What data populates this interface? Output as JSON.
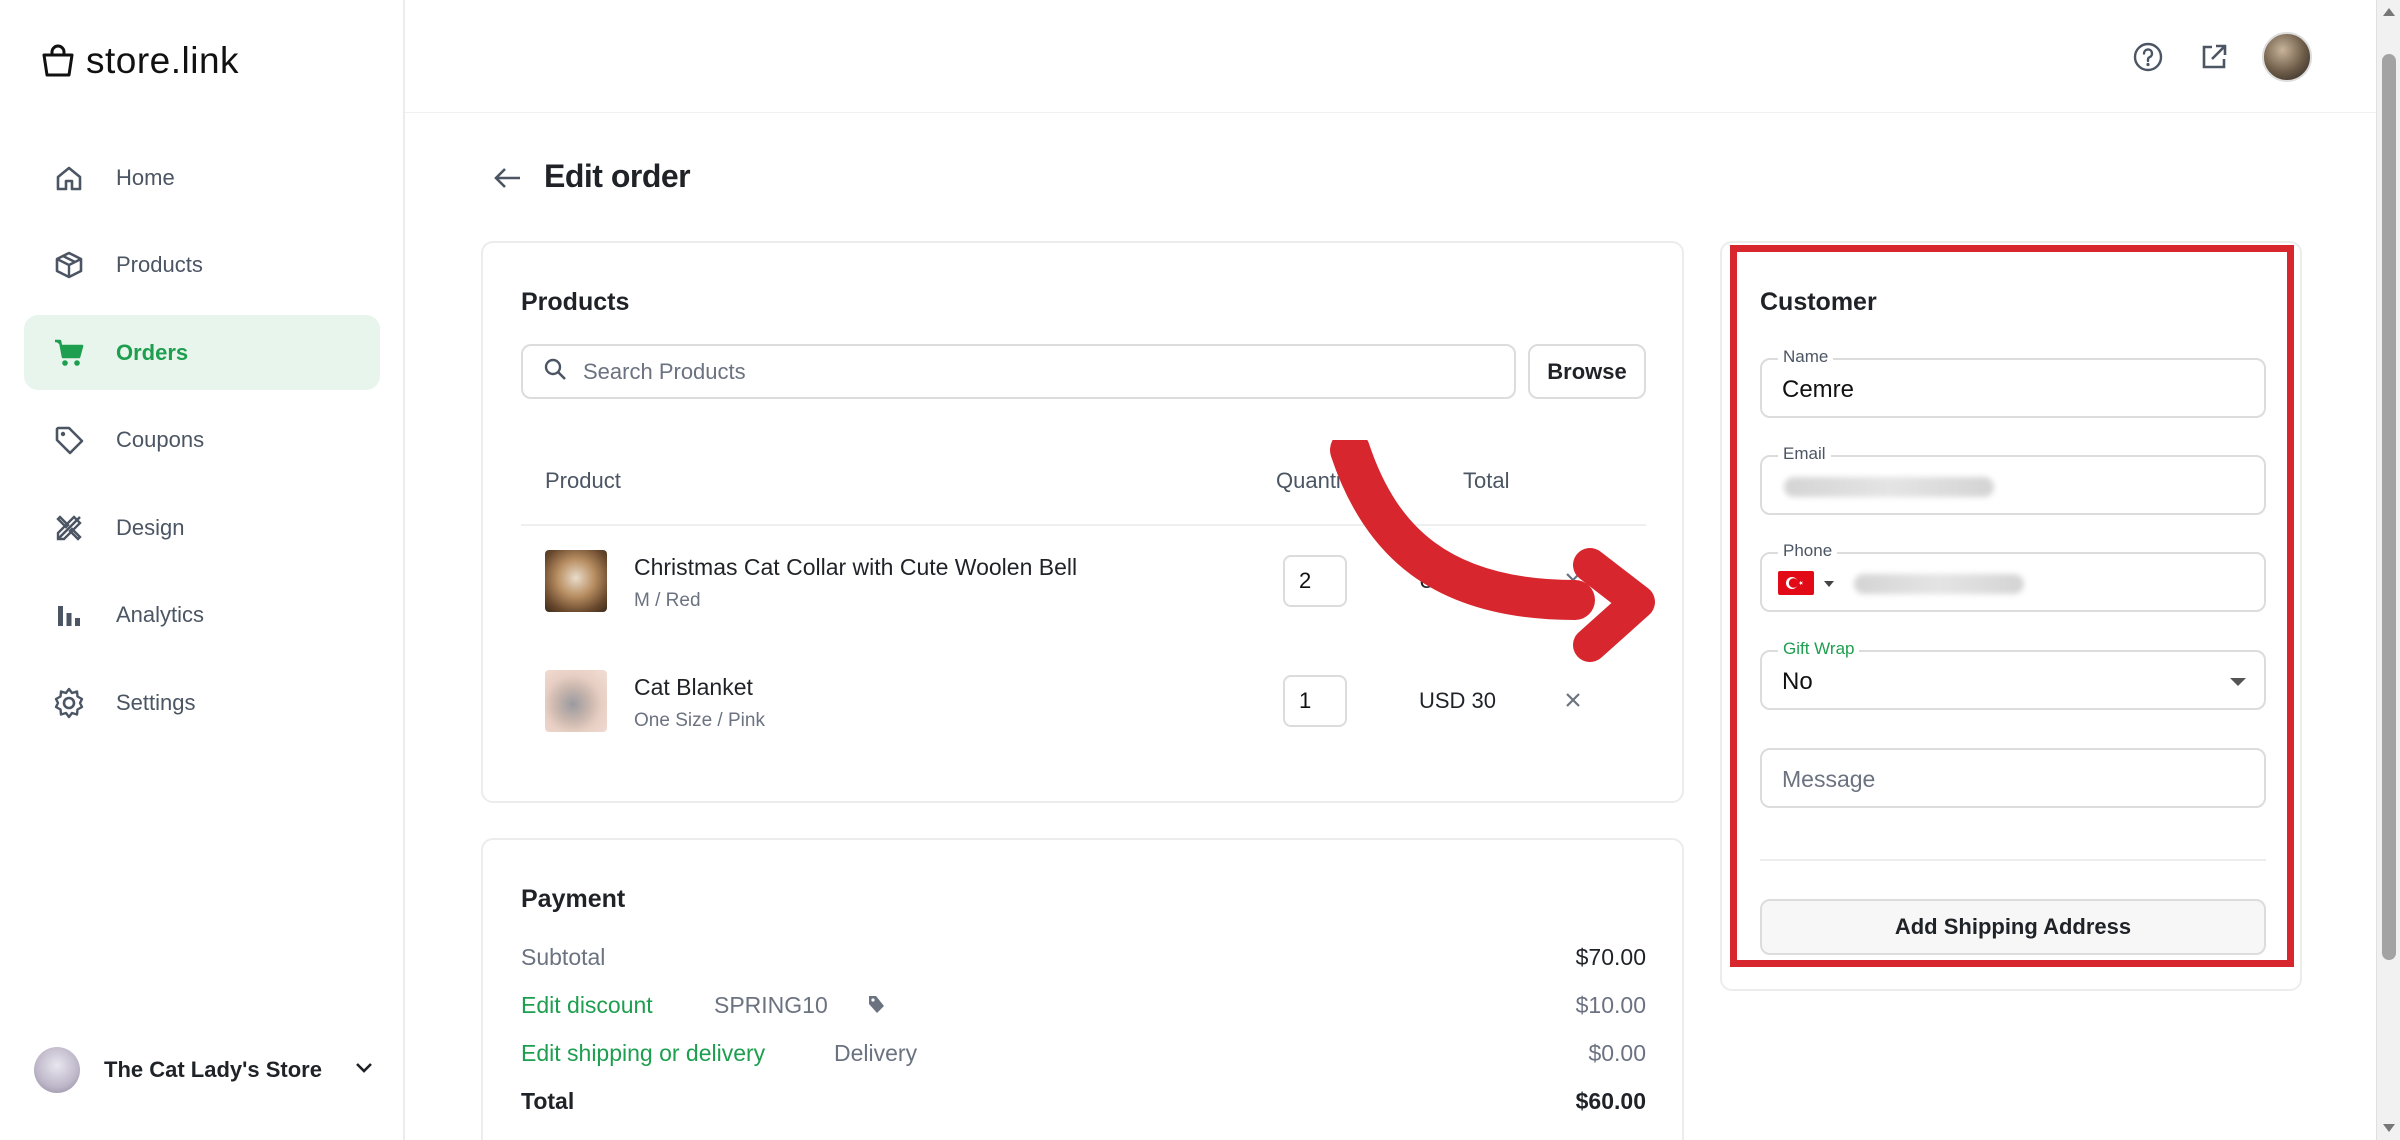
{
  "brand": {
    "name": "store.link"
  },
  "sidebar": {
    "items": [
      {
        "label": "Home",
        "icon": "home-icon",
        "active": false
      },
      {
        "label": "Products",
        "icon": "box-icon",
        "active": false
      },
      {
        "label": "Orders",
        "icon": "cart-icon",
        "active": true
      },
      {
        "label": "Coupons",
        "icon": "tag-icon",
        "active": false
      },
      {
        "label": "Design",
        "icon": "design-tools-icon",
        "active": false
      },
      {
        "label": "Analytics",
        "icon": "bar-chart-icon",
        "active": false
      },
      {
        "label": "Settings",
        "icon": "gear-icon",
        "active": false
      }
    ],
    "store_name": "The Cat Lady's Store"
  },
  "header": {
    "icons": [
      "help-icon",
      "external-link-icon",
      "user-avatar"
    ]
  },
  "page": {
    "title": "Edit order"
  },
  "products": {
    "title": "Products",
    "search_placeholder": "Search Products",
    "browse_label": "Browse",
    "columns": [
      "Product",
      "Quantity",
      "Total"
    ],
    "columns_display": [
      "Product",
      "Quanti",
      "Total"
    ],
    "rows": [
      {
        "name": "Christmas Cat Collar with Cute Woolen Bell",
        "variant": "M / Red",
        "quantity": "2",
        "total": "USD 40",
        "total_display": "U    40"
      },
      {
        "name": "Cat Blanket",
        "variant": "One Size / Pink",
        "quantity": "1",
        "total": "USD 30",
        "total_display": "USD 30"
      }
    ]
  },
  "payment": {
    "title": "Payment",
    "subtotal_label": "Subtotal",
    "subtotal_value": "$70.00",
    "discount_label": "Edit discount",
    "discount_code": "SPRING10",
    "discount_value": "$10.00",
    "shipping_label": "Edit shipping or delivery",
    "shipping_method": "Delivery",
    "shipping_value": "$0.00",
    "total_label": "Total",
    "total_value": "$60.00"
  },
  "customer": {
    "title": "Customer",
    "name_label": "Name",
    "name_value": "Cemre",
    "email_label": "Email",
    "phone_label": "Phone",
    "gift_wrap_label": "Gift Wrap",
    "gift_wrap_value": "No",
    "message_placeholder": "Message",
    "add_shipping_label": "Add Shipping Address"
  },
  "colors": {
    "accent_green": "#1e9e4f",
    "active_nav_bg": "#e8f5ec",
    "annotation_red": "#d7262d"
  }
}
